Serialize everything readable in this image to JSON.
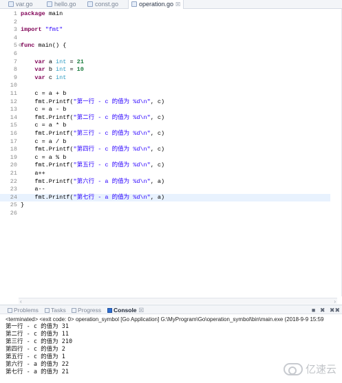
{
  "editor_tabs": [
    {
      "label": "var.go",
      "active": false
    },
    {
      "label": "hello.go",
      "active": false
    },
    {
      "label": "const.go",
      "active": false
    },
    {
      "label": "operation.go",
      "active": true,
      "close": "☒"
    }
  ],
  "code_lines": [
    {
      "n": "1",
      "tokens": [
        [
          "kw",
          "package"
        ],
        [
          "pl",
          " main"
        ]
      ]
    },
    {
      "n": "2",
      "tokens": []
    },
    {
      "n": "3",
      "tokens": [
        [
          "kw",
          "import"
        ],
        [
          "pl",
          " "
        ],
        [
          "str",
          "\"fmt\""
        ]
      ]
    },
    {
      "n": "4",
      "tokens": []
    },
    {
      "n": "5",
      "fold": "⊖",
      "tokens": [
        [
          "kw",
          "func"
        ],
        [
          "pl",
          " main() {"
        ]
      ]
    },
    {
      "n": "6",
      "tokens": []
    },
    {
      "n": "7",
      "tokens": [
        [
          "pl",
          "    "
        ],
        [
          "kw",
          "var"
        ],
        [
          "pl",
          " a "
        ],
        [
          "ty",
          "int"
        ],
        [
          "pl",
          " = "
        ],
        [
          "num",
          "21"
        ]
      ]
    },
    {
      "n": "8",
      "tokens": [
        [
          "pl",
          "    "
        ],
        [
          "kw",
          "var"
        ],
        [
          "pl",
          " b "
        ],
        [
          "ty",
          "int"
        ],
        [
          "pl",
          " = "
        ],
        [
          "num",
          "10"
        ]
      ]
    },
    {
      "n": "9",
      "tokens": [
        [
          "pl",
          "    "
        ],
        [
          "kw",
          "var"
        ],
        [
          "pl",
          " c "
        ],
        [
          "ty",
          "int"
        ]
      ]
    },
    {
      "n": "10",
      "tokens": []
    },
    {
      "n": "11",
      "tokens": [
        [
          "pl",
          "    c = a + b"
        ]
      ]
    },
    {
      "n": "12",
      "tokens": [
        [
          "pl",
          "    fmt.Printf("
        ],
        [
          "str",
          "\"第一行 - c 的值为 %d\\n\""
        ],
        [
          "pl",
          ", c)"
        ]
      ]
    },
    {
      "n": "13",
      "tokens": [
        [
          "pl",
          "    c = a - b"
        ]
      ]
    },
    {
      "n": "14",
      "tokens": [
        [
          "pl",
          "    fmt.Printf("
        ],
        [
          "str",
          "\"第二行 - c 的值为 %d\\n\""
        ],
        [
          "pl",
          ", c)"
        ]
      ]
    },
    {
      "n": "15",
      "tokens": [
        [
          "pl",
          "    c = a * b"
        ]
      ]
    },
    {
      "n": "16",
      "tokens": [
        [
          "pl",
          "    fmt.Printf("
        ],
        [
          "str",
          "\"第三行 - c 的值为 %d\\n\""
        ],
        [
          "pl",
          ", c)"
        ]
      ]
    },
    {
      "n": "17",
      "tokens": [
        [
          "pl",
          "    c = a / b"
        ]
      ]
    },
    {
      "n": "18",
      "tokens": [
        [
          "pl",
          "    fmt.Printf("
        ],
        [
          "str",
          "\"第四行 - c 的值为 %d\\n\""
        ],
        [
          "pl",
          ", c)"
        ]
      ]
    },
    {
      "n": "19",
      "tokens": [
        [
          "pl",
          "    c = a % b"
        ]
      ]
    },
    {
      "n": "20",
      "tokens": [
        [
          "pl",
          "    fmt.Printf("
        ],
        [
          "str",
          "\"第五行 - c 的值为 %d\\n\""
        ],
        [
          "pl",
          ", c)"
        ]
      ]
    },
    {
      "n": "21",
      "tokens": [
        [
          "pl",
          "    a++"
        ]
      ]
    },
    {
      "n": "22",
      "tokens": [
        [
          "pl",
          "    fmt.Printf("
        ],
        [
          "str",
          "\"第六行 - a 的值为 %d\\n\""
        ],
        [
          "pl",
          ", a)"
        ]
      ]
    },
    {
      "n": "23",
      "tokens": [
        [
          "pl",
          "    a--"
        ]
      ]
    },
    {
      "n": "24",
      "current": true,
      "tokens": [
        [
          "pl",
          "    fmt.Printf("
        ],
        [
          "str",
          "\"第七行 - a 的值为 %d\\n\""
        ],
        [
          "pl",
          ", a)"
        ]
      ]
    },
    {
      "n": "25",
      "tokens": [
        [
          "pl",
          "}"
        ]
      ]
    },
    {
      "n": "26",
      "tokens": []
    }
  ],
  "panel_tabs": [
    {
      "label": "Problems",
      "active": false
    },
    {
      "label": "Tasks",
      "active": false
    },
    {
      "label": "Progress",
      "active": false
    },
    {
      "label": "Console",
      "active": true,
      "close": "☒"
    }
  ],
  "console_status": "<terminated> <exit code: 0> operation_symbol [Go Application] G:\\MyProgram\\Go\\operation_symbol\\bin\\main.exe (2018-9-9 15:59",
  "console_output": [
    "第一行 - c 的值为 31",
    "第二行 - c 的值为 11",
    "第三行 - c 的值为 210",
    "第四行 - c 的值为 2",
    "第五行 - c 的值为 1",
    "第六行 - a 的值为 22",
    "第七行 - a 的值为 21"
  ],
  "panel_actions": {
    "stop": "■",
    "remove": "✖",
    "remove_all": "✖✖"
  },
  "watermark": "亿速云",
  "colors": {
    "keyword": "#7f0055",
    "type": "#2b9ac1",
    "number": "#1a7c3d",
    "string": "#2a00ff",
    "current_line": "#e8f2fe"
  }
}
